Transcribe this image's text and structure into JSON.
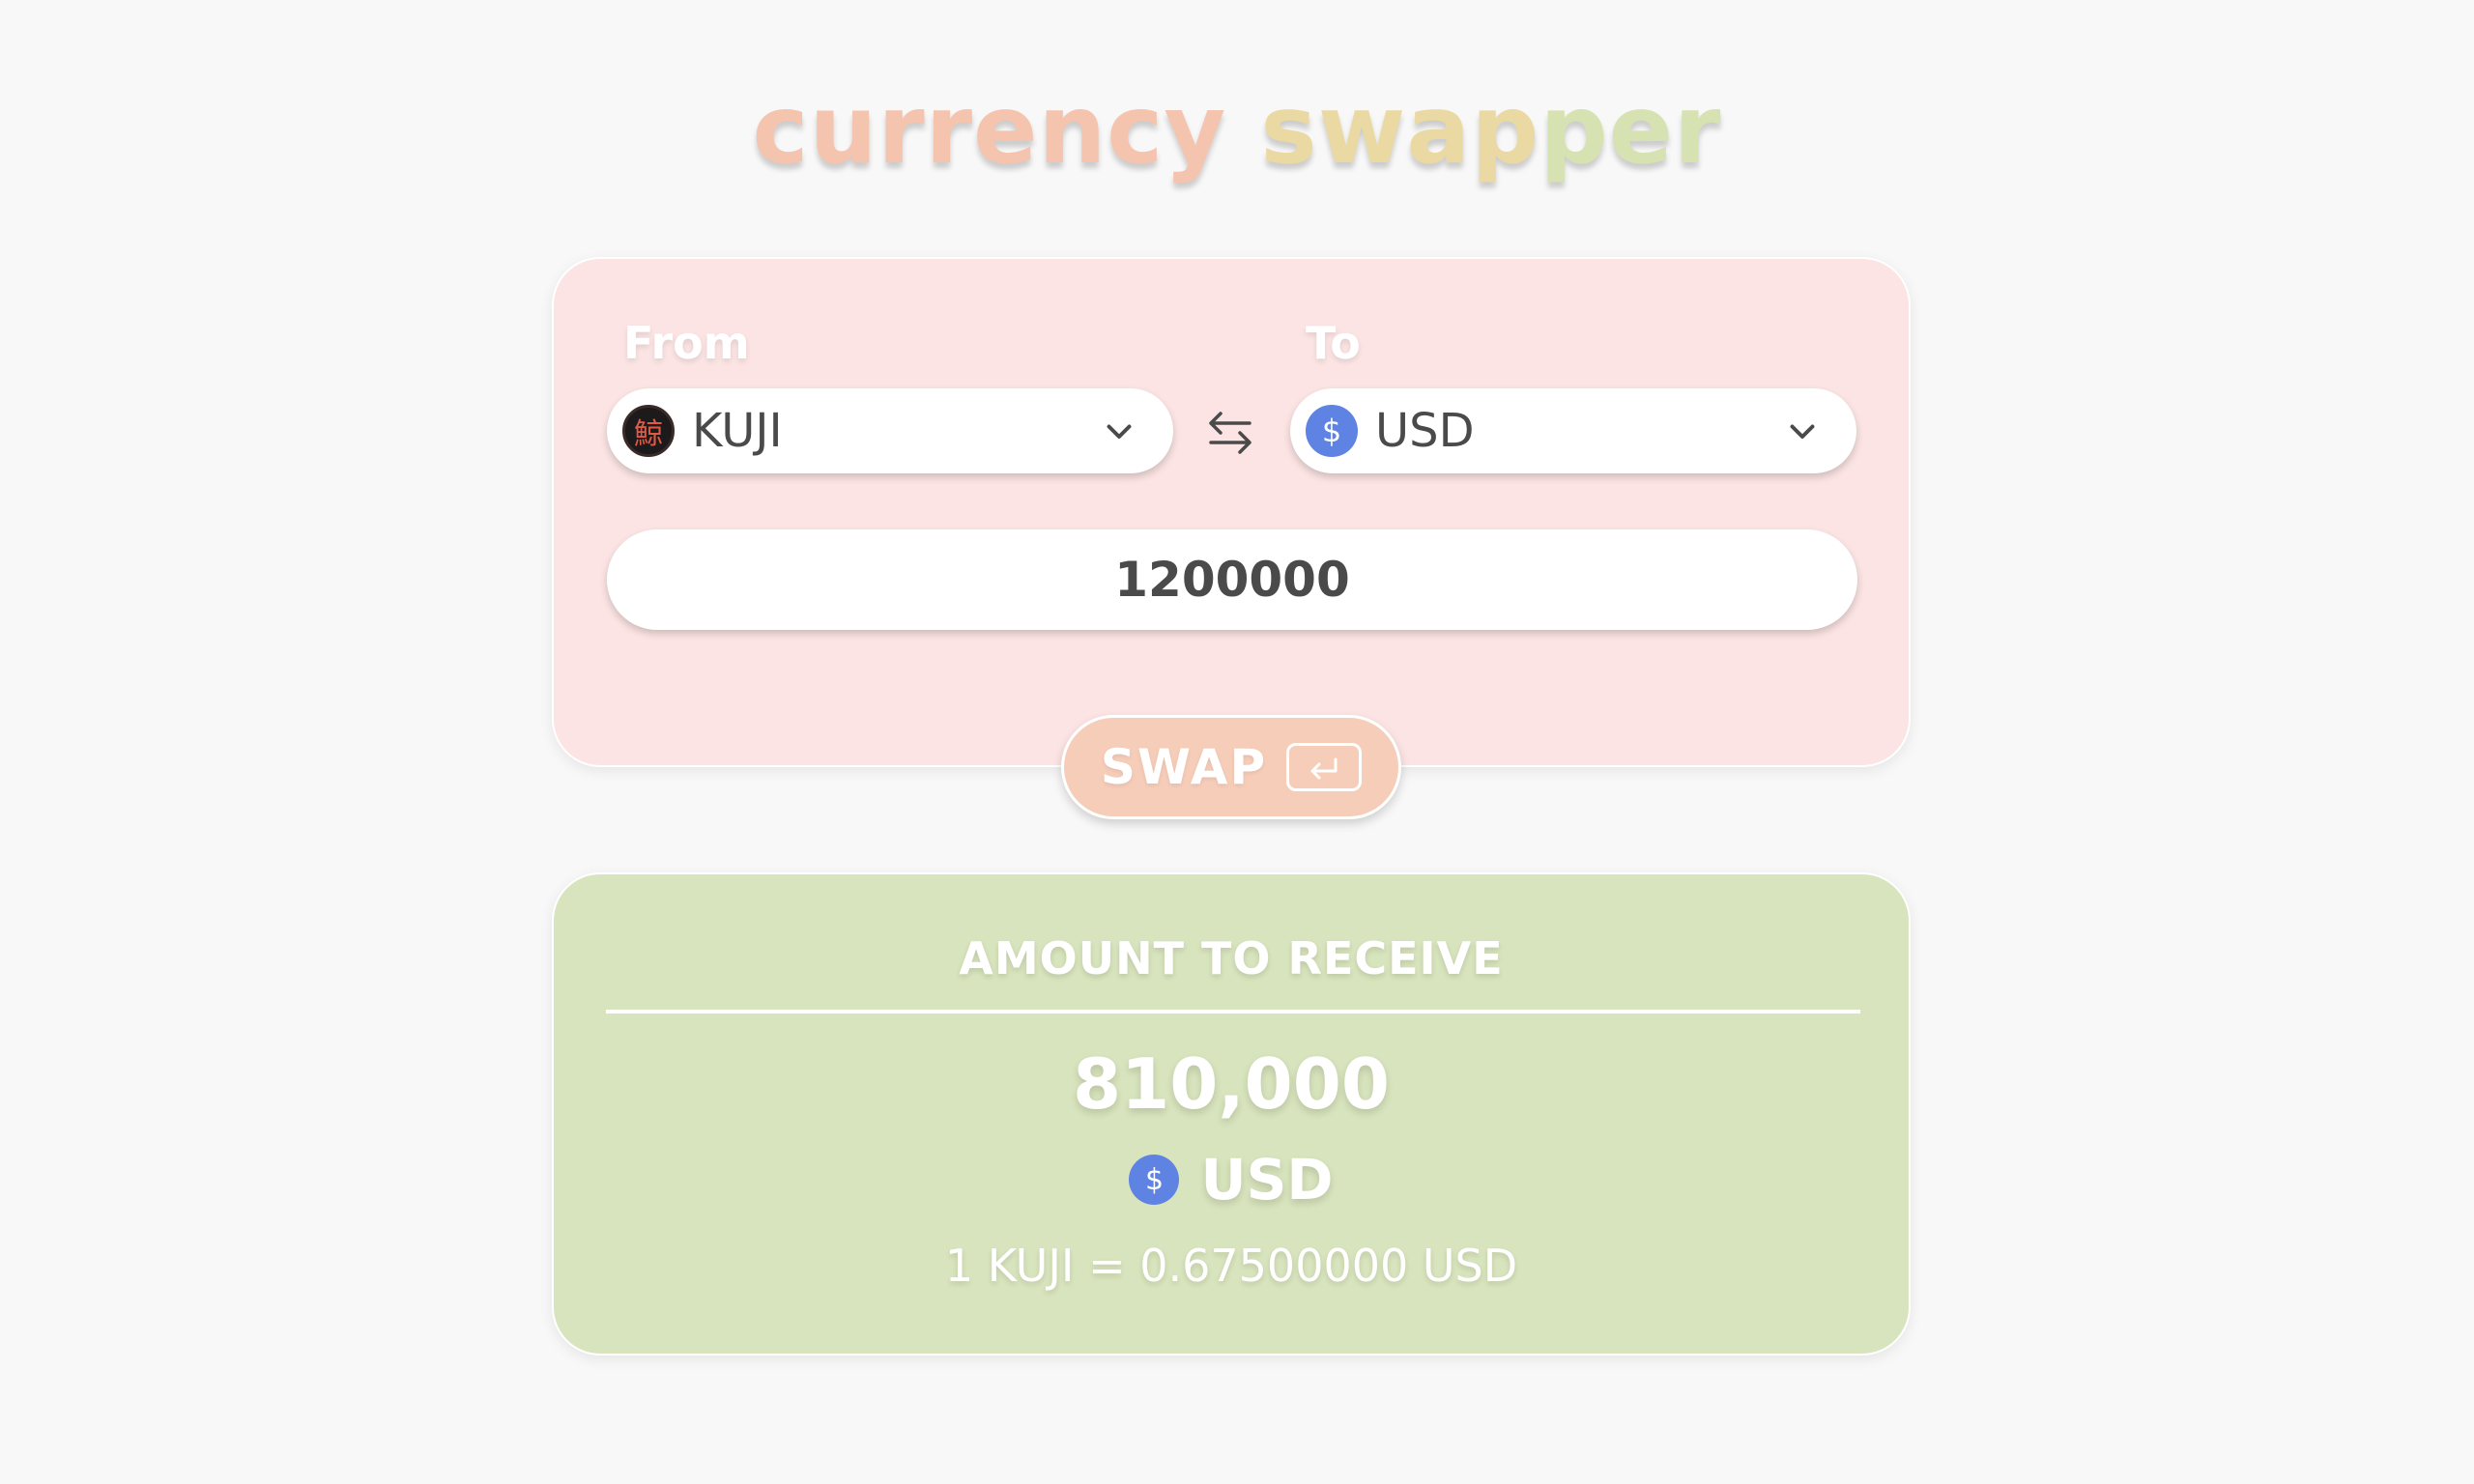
{
  "app": {
    "title_part1": "currency",
    "title_part2": " swap",
    "title_part3": "per"
  },
  "swap_form": {
    "from_label": "From",
    "to_label": "To",
    "from_currency": {
      "code": "KUJI",
      "icon": "kuji-logo-icon",
      "glyph": "鯨"
    },
    "to_currency": {
      "code": "USD",
      "icon": "usd-coin-icon",
      "glyph": "$"
    },
    "amount_value": "1200000",
    "swap_button_label": "SWAP",
    "swap_button_icon": "enter-key-icon"
  },
  "result": {
    "heading": "AMOUNT TO RECEIVE",
    "amount": "810,000",
    "currency_code": "USD",
    "currency_glyph": "$",
    "rate_text": "1 KUJI = 0.67500000 USD"
  },
  "colors": {
    "background": "#f8f8f8",
    "swap_card": "#fbe4e3",
    "result_card": "#d8e4bd",
    "swap_button": "#f6cdb9",
    "usd_icon": "#5f83e2",
    "kuji_icon": "#1c1a1a",
    "kuji_glyph": "#e05a45",
    "text_dark": "#4a4a4a",
    "title_orange": "#f4c4ae",
    "title_yellow": "#ead9a3",
    "title_green": "#d6e2b2"
  }
}
